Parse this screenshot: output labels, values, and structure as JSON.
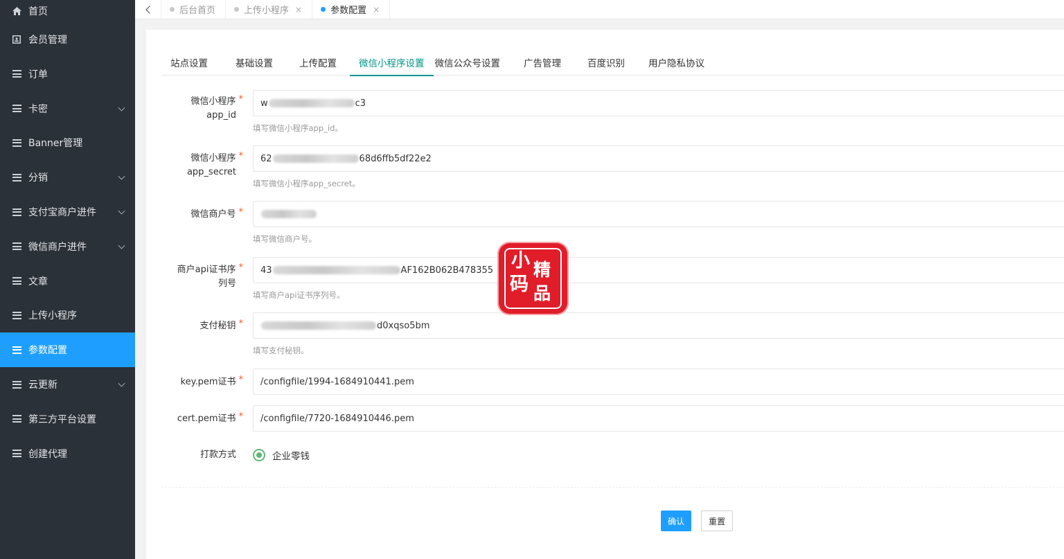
{
  "sidebar": {
    "items": [
      {
        "label": "首页",
        "icon": "home-icon",
        "expandable": false
      },
      {
        "label": "会员管理",
        "icon": "member-card-icon",
        "expandable": false
      },
      {
        "label": "订单",
        "icon": "list-icon",
        "expandable": false
      },
      {
        "label": "卡密",
        "icon": "list-icon",
        "expandable": true
      },
      {
        "label": "Banner管理",
        "icon": "list-icon",
        "expandable": false
      },
      {
        "label": "分销",
        "icon": "list-icon",
        "expandable": true
      },
      {
        "label": "支付宝商户进件",
        "icon": "list-icon",
        "expandable": true
      },
      {
        "label": "微信商户进件",
        "icon": "list-icon",
        "expandable": true
      },
      {
        "label": "文章",
        "icon": "list-icon",
        "expandable": false
      },
      {
        "label": "上传小程序",
        "icon": "list-icon",
        "expandable": false
      },
      {
        "label": "参数配置",
        "icon": "list-icon",
        "expandable": false,
        "active": true
      },
      {
        "label": "云更新",
        "icon": "list-icon",
        "expandable": true
      },
      {
        "label": "第三方平台设置",
        "icon": "list-icon",
        "expandable": false
      },
      {
        "label": "创建代理",
        "icon": "list-icon",
        "expandable": false
      }
    ]
  },
  "page_tabs": [
    {
      "label": "后台首页",
      "closable": false,
      "active": false
    },
    {
      "label": "上传小程序",
      "closable": true,
      "active": false
    },
    {
      "label": "参数配置",
      "closable": true,
      "active": true
    }
  ],
  "close_glyph": "×",
  "settings_tabs": [
    "站点设置",
    "基础设置",
    "上传配置",
    "微信小程序设置",
    "微信公众号设置",
    "广告管理",
    "百度识别",
    "用户隐私协议"
  ],
  "active_settings_tab": "微信小程序设置",
  "required_mark": "*",
  "form": {
    "app_id": {
      "label_line1": "微信小程序",
      "label_line2": "app_id",
      "value_prefix": "w",
      "value_suffix": "c3",
      "hint": "填写微信小程序app_id。"
    },
    "app_secret": {
      "label_line1": "微信小程序",
      "label_line2": "app_secret",
      "value_prefix": "62",
      "value_suffix": "68d6ffb5df22e2",
      "hint": "填写微信小程序app_secret。"
    },
    "merchant_id": {
      "label": "微信商户号",
      "hint": "填写微信商户号。"
    },
    "cert_serial": {
      "label_line1": "商户api证书序",
      "label_line2": "列号",
      "value_prefix": "43",
      "value_suffix": "AF162B062B478355",
      "hint": "填写商户api证书序列号。"
    },
    "pay_key": {
      "label": "支付秘钥",
      "value_suffix": "d0xqso5bm",
      "hint": "填写支付秘钥。"
    },
    "key_pem": {
      "label": "key.pem证书",
      "value": "/configfile/1994-1684910441.pem"
    },
    "cert_pem": {
      "label": "cert.pem证书",
      "value": "/configfile/7720-1684910446.pem"
    },
    "payout": {
      "label": "打款方式",
      "option": "企业零钱"
    }
  },
  "buttons": {
    "confirm": "确认",
    "reset": "重置"
  },
  "stamp": {
    "chars": [
      "小",
      "精",
      "码",
      "品"
    ]
  },
  "colors": {
    "sidebar_bg": "#2b3138",
    "active_blue": "#1e9fff",
    "tab_green": "#009688",
    "radio_green": "#5fb878",
    "required_red": "#ff5722",
    "stamp_red": "#e11d2a"
  }
}
